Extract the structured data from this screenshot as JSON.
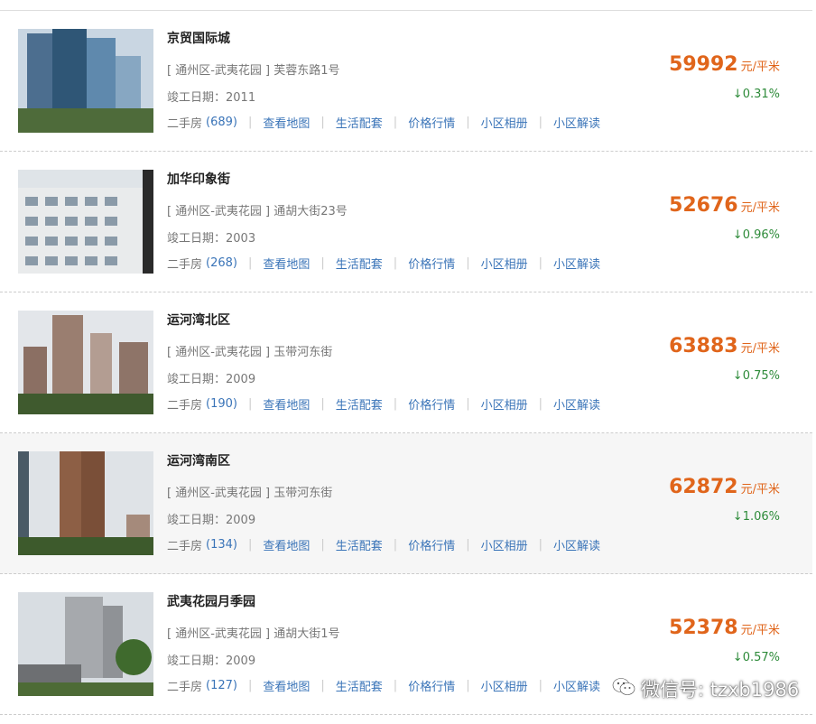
{
  "unit": "元/平米",
  "labels": {
    "built_prefix": "竣工日期：",
    "second_hand": "二手房",
    "links": [
      "查看地图",
      "生活配套",
      "价格行情",
      "小区相册",
      "小区解读"
    ]
  },
  "items": [
    {
      "name": "京贸国际城",
      "address": "[ 通州区-武夷花园 ] 芙蓉东路1号",
      "built": "2011",
      "count": "(689)",
      "price": "59992",
      "change": "↓0.31%"
    },
    {
      "name": "加华印象街",
      "address": "[ 通州区-武夷花园 ] 通胡大街23号",
      "built": "2003",
      "count": "(268)",
      "price": "52676",
      "change": "↓0.96%"
    },
    {
      "name": "运河湾北区",
      "address": "[ 通州区-武夷花园 ] 玉带河东街",
      "built": "2009",
      "count": "(190)",
      "price": "63883",
      "change": "↓0.75%"
    },
    {
      "name": "运河湾南区",
      "address": "[ 通州区-武夷花园 ] 玉带河东街",
      "built": "2009",
      "count": "(134)",
      "price": "62872",
      "change": "↓1.06%"
    },
    {
      "name": "武夷花园月季园",
      "address": "[ 通州区-武夷花园 ] 通胡大街1号",
      "built": "2009",
      "count": "(127)",
      "price": "52378",
      "change": "↓0.57%"
    }
  ],
  "watermark": "微信号: tzxb1986",
  "colors": {
    "price": "#e0651b",
    "change_down": "#2e8b3a",
    "link": "#3a74b8"
  },
  "icons": [
    "wechat-icon"
  ]
}
